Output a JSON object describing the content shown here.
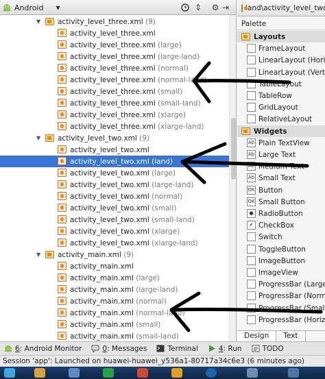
{
  "project_panel": {
    "view_label": "Android",
    "tree": [
      {
        "type": "folder",
        "name": "activity_level_three.xml",
        "count": "(9)"
      },
      {
        "type": "file",
        "name": "activity_level_three.xml",
        "qualifier": ""
      },
      {
        "type": "file",
        "name": "activity_level_three.xml",
        "qualifier": "(large)"
      },
      {
        "type": "file",
        "name": "activity_level_three.xml",
        "qualifier": "(large-land)"
      },
      {
        "type": "file",
        "name": "activity_level_three.xml",
        "qualifier": "(normal)"
      },
      {
        "type": "file",
        "name": "activity_level_three.xml",
        "qualifier": "(normal-land)"
      },
      {
        "type": "file",
        "name": "activity_level_three.xml",
        "qualifier": "(small)"
      },
      {
        "type": "file",
        "name": "activity_level_three.xml",
        "qualifier": "(small-land)"
      },
      {
        "type": "file",
        "name": "activity_level_three.xml",
        "qualifier": "(xlarge)"
      },
      {
        "type": "file",
        "name": "activity_level_three.xml",
        "qualifier": "(xlarge-land)"
      },
      {
        "type": "folder",
        "name": "activity_level_two.xml",
        "count": "(9)"
      },
      {
        "type": "file",
        "name": "activity_level_two.xml",
        "qualifier": ""
      },
      {
        "type": "file",
        "name": "activity_level_two.xml",
        "qualifier": "(land)",
        "selected": true
      },
      {
        "type": "file",
        "name": "activity_level_two.xml",
        "qualifier": "(large)"
      },
      {
        "type": "file",
        "name": "activity_level_two.xml",
        "qualifier": "(large-land)"
      },
      {
        "type": "file",
        "name": "activity_level_two.xml",
        "qualifier": "(normal)"
      },
      {
        "type": "file",
        "name": "activity_level_two.xml",
        "qualifier": "(small)"
      },
      {
        "type": "file",
        "name": "activity_level_two.xml",
        "qualifier": "(small-land)"
      },
      {
        "type": "file",
        "name": "activity_level_two.xml",
        "qualifier": "(xlarge)"
      },
      {
        "type": "file",
        "name": "activity_level_two.xml",
        "qualifier": "(xlarge-land)"
      },
      {
        "type": "folder",
        "name": "activity_main.xml",
        "count": "(9)"
      },
      {
        "type": "file",
        "name": "activity_main.xml",
        "qualifier": ""
      },
      {
        "type": "file",
        "name": "activity_main.xml",
        "qualifier": "(large)"
      },
      {
        "type": "file",
        "name": "activity_main.xml",
        "qualifier": "(large-land)"
      },
      {
        "type": "file",
        "name": "activity_main.xml",
        "qualifier": "(normal)"
      },
      {
        "type": "file",
        "name": "activity_main.xml",
        "qualifier": "(normal-land)"
      },
      {
        "type": "file",
        "name": "activity_main.xml",
        "qualifier": "(small)"
      },
      {
        "type": "file",
        "name": "activity_main.xml",
        "qualifier": "(small-land)"
      }
    ]
  },
  "editor": {
    "tab_title": "land\\activity_level_two.xml"
  },
  "palette": {
    "title": "Palette",
    "items": [
      {
        "kind": "category",
        "label": "Layouts"
      },
      {
        "kind": "item",
        "label": "FrameLayout",
        "icon": "frame-layout-icon",
        "glyph": ""
      },
      {
        "kind": "item",
        "label": "LinearLayout (Horizontal)",
        "icon": "linear-layout-horizontal-icon",
        "glyph": ""
      },
      {
        "kind": "item",
        "label": "LinearLayout (Vertical)",
        "icon": "linear-layout-vertical-icon",
        "glyph": ""
      },
      {
        "kind": "item",
        "label": "TableLayout",
        "icon": "table-layout-icon",
        "glyph": ""
      },
      {
        "kind": "item",
        "label": "TableRow",
        "icon": "table-row-icon",
        "glyph": ""
      },
      {
        "kind": "item",
        "label": "GridLayout",
        "icon": "grid-layout-icon",
        "glyph": ""
      },
      {
        "kind": "item",
        "label": "RelativeLayout",
        "icon": "relative-layout-icon",
        "glyph": ""
      },
      {
        "kind": "category",
        "label": "Widgets"
      },
      {
        "kind": "item",
        "label": "Plain TextView",
        "icon": "textview-icon",
        "glyph": "Ab"
      },
      {
        "kind": "item",
        "label": "Large Text",
        "icon": "large-text-icon",
        "glyph": "Ab"
      },
      {
        "kind": "item",
        "label": "Medium Text",
        "icon": "medium-text-icon",
        "glyph": "Ab"
      },
      {
        "kind": "item",
        "label": "Small Text",
        "icon": "small-text-icon",
        "glyph": "Ab"
      },
      {
        "kind": "item",
        "label": "Button",
        "icon": "button-icon",
        "glyph": "OK"
      },
      {
        "kind": "item",
        "label": "Small Button",
        "icon": "small-button-icon",
        "glyph": "OK"
      },
      {
        "kind": "item",
        "label": "RadioButton",
        "icon": "radio-button-icon",
        "glyph": "●"
      },
      {
        "kind": "item",
        "label": "CheckBox",
        "icon": "checkbox-icon",
        "glyph": "✔"
      },
      {
        "kind": "item",
        "label": "Switch",
        "icon": "switch-icon",
        "glyph": ""
      },
      {
        "kind": "item",
        "label": "ToggleButton",
        "icon": "toggle-button-icon",
        "glyph": ""
      },
      {
        "kind": "item",
        "label": "ImageButton",
        "icon": "image-button-icon",
        "glyph": ""
      },
      {
        "kind": "item",
        "label": "ImageView",
        "icon": "image-view-icon",
        "glyph": ""
      },
      {
        "kind": "item",
        "label": "ProgressBar (Large)",
        "icon": "progressbar-large-icon",
        "glyph": ""
      },
      {
        "kind": "item",
        "label": "ProgressBar (Normal)",
        "icon": "progressbar-normal-icon",
        "glyph": ""
      },
      {
        "kind": "item",
        "label": "ProgressBar (Small)",
        "icon": "progressbar-small-icon",
        "glyph": ""
      },
      {
        "kind": "item",
        "label": "ProgressBar (Horizontal)",
        "icon": "progressbar-horizontal-icon",
        "glyph": ""
      }
    ],
    "tabs": {
      "design": "Design",
      "text": "Text"
    }
  },
  "tool_windows": {
    "android_monitor": {
      "key": "6",
      "label": ": Android Monitor"
    },
    "messages": {
      "key": "0",
      "label": ": Messages"
    },
    "terminal": {
      "label": "Terminal"
    },
    "run": {
      "key": "4",
      "label": ": Run"
    },
    "todo": {
      "label": "TODO"
    }
  },
  "status": {
    "text": "Session 'app': Launched on huawei-huawei_y536a1-80717a34c6e3 (6 minutes ago)"
  },
  "colors": {
    "selection": "#3875d7",
    "qualifier_gray": "#7a7a7a",
    "taskbar": "#1d3e6a"
  }
}
